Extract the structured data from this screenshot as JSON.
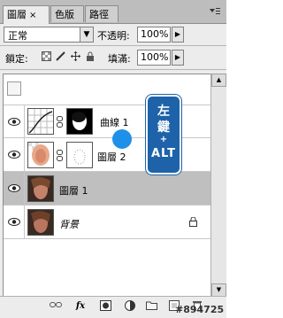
{
  "tabs": [
    {
      "label": "圖層",
      "close": "×"
    },
    {
      "label": "色版"
    },
    {
      "label": "路徑"
    }
  ],
  "blend_mode": "正常",
  "opacity_label": "不透明:",
  "opacity_value": "100%",
  "lock_label": "鎖定:",
  "fill_label": "填滿:",
  "fill_value": "100%",
  "layers": [
    {
      "name": "曲線 1"
    },
    {
      "name": "圖層 2"
    },
    {
      "name": "圖層 1"
    },
    {
      "name": "背景"
    }
  ],
  "callout": {
    "line1": "左",
    "line2": "鍵",
    "line3": "+",
    "line4": "ALT"
  },
  "watermark": "#894725",
  "colors": {
    "callout": "#1e63a9",
    "dot": "#1e90e8",
    "selected_row": "#bfbfbf"
  }
}
